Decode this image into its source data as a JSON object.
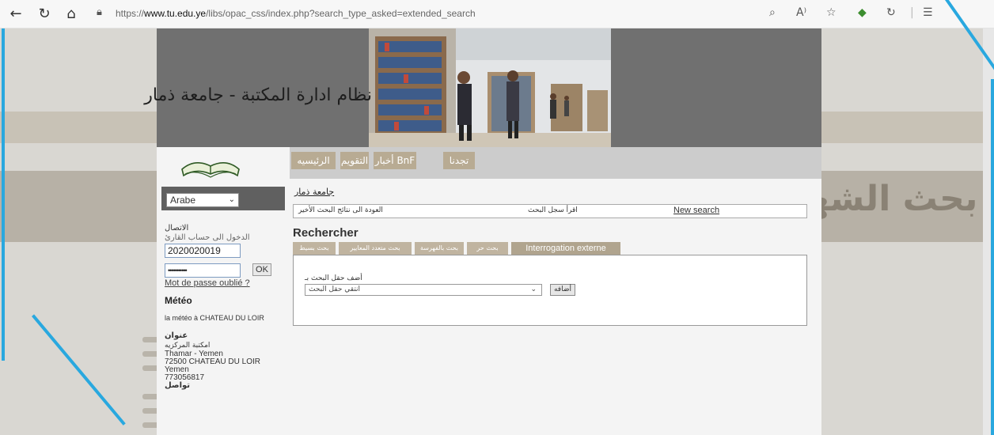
{
  "browser": {
    "url_prefix": "https://",
    "url_host": "www.tu.edu.ye",
    "url_path": "/libs/opac_css/index.php?search_type_asked=extended_search"
  },
  "banner": {
    "title": "نظام ادارة المكتبة - جامعة ذمار"
  },
  "menu": {
    "items": [
      "تجدنا",
      "BnF أخبار",
      "التقويم",
      "الرئيسيه"
    ]
  },
  "sidebar": {
    "language": "Arabe",
    "connection_label": "الاتصال",
    "account_label": "الدخول الى حساب القارئ",
    "username": "2020020019",
    "password": "•••••••••••",
    "ok_label": "OK",
    "forgot_password": "Mot de passe oublié ?",
    "meteo_title": "Météo",
    "meteo_text": "la météo à CHATEAU DU LOIR",
    "address_title": "عنوان",
    "address_lines": [
      "امكتبة المركزيه",
      "Thamar - Yemen",
      "72500 CHATEAU DU LOIR",
      "Yemen",
      "773056817"
    ],
    "contact_label": "تواصل"
  },
  "main": {
    "site_link": "جامعة ذمار",
    "nav": {
      "back_results": "العودة الى نتائج البحث الأخير",
      "search_history": "اقرأ سجل البحث",
      "new_search": "New search"
    },
    "heading": "Rechercher",
    "tabs": [
      "بحث بسيط",
      "بحث متعدد المعايير",
      "بحث بالفهرسة",
      "بحث حر",
      "Interrogation externe"
    ],
    "panel": {
      "field_label": "أضف حقل البحث بـ",
      "field_select": "انتقي حقل البحث",
      "add_button": "أضافه"
    }
  },
  "backdrop": {
    "title_text": "مجله بحث الشهيد الصباح"
  },
  "colors": {
    "accent_frame": "#29a8df",
    "menu_tab": "#b8ab93",
    "banner_gray": "#707070"
  }
}
